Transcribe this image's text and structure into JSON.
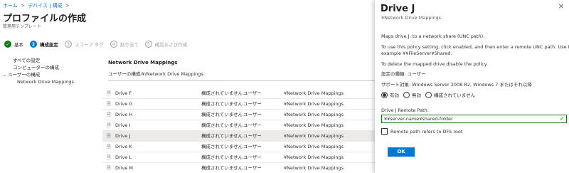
{
  "breadcrumb": {
    "items": [
      "ホーム",
      "デバイス | 構成"
    ],
    "separator": ">"
  },
  "page": {
    "title": "プロファイルの作成",
    "subtitle": "管理用テンプレート"
  },
  "steps": [
    {
      "label": "基本",
      "badge": "✓",
      "state": "done"
    },
    {
      "label": "構成設定",
      "badge": "2",
      "state": "active"
    },
    {
      "label": "スコープ タグ",
      "badge": "3",
      "state": "pending"
    },
    {
      "label": "割り当て",
      "badge": "4",
      "state": "pending"
    },
    {
      "label": "確認および作成",
      "badge": "5",
      "state": "pending"
    }
  ],
  "tree": {
    "all_settings": "すべての設定",
    "computer_config": "コンピューターの構成",
    "user_config": "ユーザーの構成",
    "network_drive": "Network Drive Mappings"
  },
  "section": {
    "title": "Network Drive Mappings",
    "path": "ユーザーの構成/¥/Network Drive Mappings"
  },
  "table": {
    "rows": [
      {
        "name": "Drive F",
        "state": "構成されていません",
        "scope": "ユーザー",
        "path": "¥Network Drive Mappings"
      },
      {
        "name": "Drive G",
        "state": "構成されていません",
        "scope": "ユーザー",
        "path": "¥Network Drive Mappings"
      },
      {
        "name": "Drive H",
        "state": "構成されていません",
        "scope": "ユーザー",
        "path": "¥Network Drive Mappings"
      },
      {
        "name": "Drive I",
        "state": "構成されていません",
        "scope": "ユーザー",
        "path": "¥Network Drive Mappings"
      },
      {
        "name": "Drive J",
        "state": "構成されていません",
        "scope": "ユーザー",
        "path": "¥Network Drive Mappings",
        "selected": true
      },
      {
        "name": "Drive K",
        "state": "構成されていません",
        "scope": "ユーザー",
        "path": "¥Network Drive Mappings"
      },
      {
        "name": "Drive L",
        "state": "構成されていません",
        "scope": "ユーザー",
        "path": "¥Network Drive Mappings"
      },
      {
        "name": "Drive M",
        "state": "構成されていません",
        "scope": "ユーザー",
        "path": "¥Network Drive Mappings"
      }
    ]
  },
  "pane": {
    "title": "Drive J",
    "subtitle": "¥Network Drive Mappings",
    "desc1": "Maps drive J: to a network share (UNC path).",
    "desc2a": "To use this policy setting, click enabled, and then enter a remote UNC path.  Use this",
    "desc2b": "example ¥¥FileServer¥Shared.",
    "desc3": "To delete the mapped drive disable the policy.",
    "setting_type": "設定の種類: ユーザー",
    "supported": "サポート対象: Windows Server 2008 R2, Windows 7 またはそれ以降",
    "radios": [
      {
        "label": "有効",
        "selected": true
      },
      {
        "label": "無効",
        "selected": false
      },
      {
        "label": "構成されていません",
        "selected": false
      }
    ],
    "field_label": "Drive J Remote Path:",
    "field_value": "¥¥server-name¥shared-folder",
    "checkbox_label": "Remote path refers to DFS root",
    "ok_label": "OK",
    "close_glyph": "×"
  },
  "icons": {
    "setting_row": "document-icon",
    "close": "close-icon"
  },
  "colors": {
    "accent": "#0078d4",
    "success": "#107c10",
    "selected_row": "#edebe9"
  }
}
